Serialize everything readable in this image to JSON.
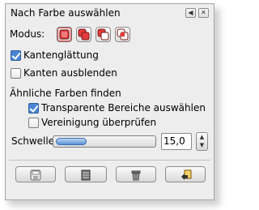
{
  "dialog": {
    "title": "Nach Farbe auswählen",
    "mode_label": "Modus:",
    "antialias_label": "Kantenglättung",
    "antialias_checked": true,
    "feather_label": "Kanten ausblenden",
    "feather_checked": false,
    "similar_heading": "Ähnliche Farben finden",
    "transparent_label": "Transparente Bereiche auswählen",
    "transparent_checked": true,
    "merged_label": "Vereinigung überprüfen",
    "merged_checked": false,
    "threshold_label": "Schwelle:",
    "threshold_value": "15,0",
    "threshold_fraction": 0.06
  },
  "title_buttons": [
    {
      "name": "configure-icon",
      "glyph": "◀"
    },
    {
      "name": "close-icon",
      "glyph": "✕"
    }
  ],
  "mode_buttons": [
    {
      "name": "mode-replace-icon",
      "active": true
    },
    {
      "name": "mode-add-icon",
      "active": false
    },
    {
      "name": "mode-subtract-icon",
      "active": false
    },
    {
      "name": "mode-intersect-icon",
      "active": false
    }
  ],
  "bottom_buttons": [
    {
      "name": "save-preset-icon"
    },
    {
      "name": "restore-preset-icon"
    },
    {
      "name": "delete-preset-icon"
    },
    {
      "name": "reset-icon"
    }
  ],
  "colors": {
    "accent_blue": "#4a86d4",
    "mode_red": "#e33b3b"
  }
}
